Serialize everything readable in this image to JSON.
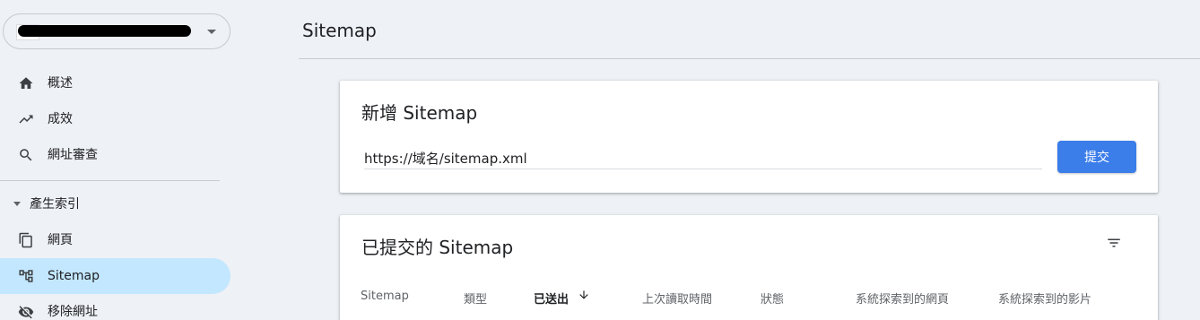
{
  "sidebar": {
    "nav": [
      {
        "label": "概述",
        "icon": "home-icon"
      },
      {
        "label": "成效",
        "icon": "trending-up-icon"
      },
      {
        "label": "網址審查",
        "icon": "search-icon"
      }
    ],
    "section": {
      "label": "產生索引"
    },
    "index_items": [
      {
        "label": "網頁",
        "icon": "pages-icon"
      },
      {
        "label": "Sitemap",
        "icon": "sitemap-icon",
        "active": true
      },
      {
        "label": "移除網址",
        "icon": "visibility-off-icon"
      }
    ]
  },
  "page": {
    "title": "Sitemap"
  },
  "add_card": {
    "title": "新增 Sitemap",
    "input_value": "https://域名/sitemap.xml",
    "submit_label": "提交"
  },
  "submitted_card": {
    "title": "已提交的 Sitemap",
    "columns": [
      "Sitemap",
      "類型",
      "已送出",
      "上次讀取時間",
      "狀態",
      "系統探索到的網頁",
      "系統探索到的影片"
    ]
  },
  "colors": {
    "accent": "#3b7de9",
    "active_nav": "#c2e7ff",
    "background": "#eef1f5"
  }
}
